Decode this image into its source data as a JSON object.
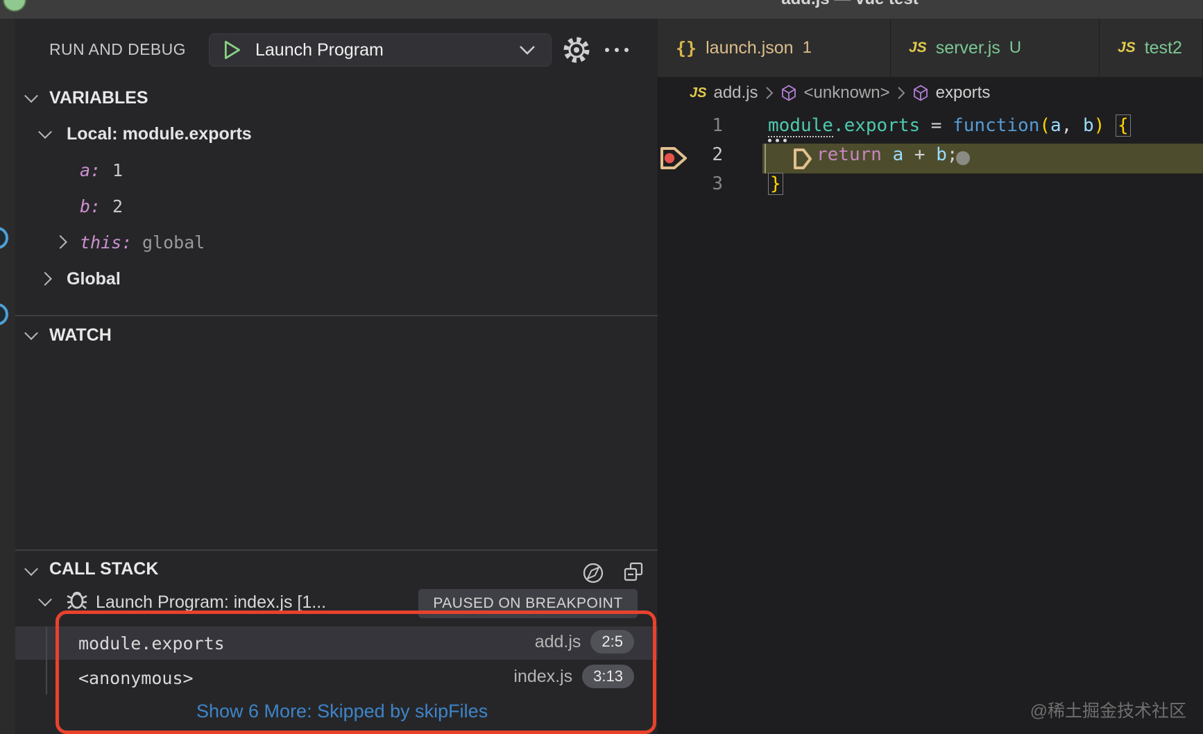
{
  "title_bar": {
    "title": "add.js — vue test"
  },
  "sidebar": {
    "header": {
      "label": "RUN AND DEBUG",
      "config_name": "Launch Program",
      "more_actions": "···"
    },
    "variables": {
      "header": "VARIABLES",
      "scope_local": "Local: module.exports",
      "items": [
        {
          "name": "a:",
          "value": "1"
        },
        {
          "name": "b:",
          "value": "2"
        },
        {
          "name": "this:",
          "value": "global"
        }
      ],
      "scope_global": "Global"
    },
    "watch": {
      "header": "WATCH"
    },
    "call_stack": {
      "header": "CALL STACK",
      "session_label": "Launch Program: index.js [1...",
      "status_badge": "PAUSED ON BREAKPOINT",
      "frames": [
        {
          "fn": "module.exports",
          "file": "add.js",
          "pos": "2:5"
        },
        {
          "fn": "<anonymous>",
          "file": "index.js",
          "pos": "3:13"
        }
      ],
      "skip_link": "Show 6 More: Skipped by skipFiles"
    }
  },
  "editor": {
    "tabs": [
      {
        "icon": "{}",
        "label": "launch.json",
        "badge": "1"
      },
      {
        "icon": "JS",
        "label": "server.js",
        "badge": "U"
      },
      {
        "icon": "JS",
        "label": "test2",
        "badge": ""
      }
    ],
    "breadcrumb": {
      "file_icon": "JS",
      "file": "add.js",
      "symbol1": "<unknown>",
      "symbol2": "exports"
    },
    "code": {
      "line_numbers": [
        "1",
        "2",
        "3"
      ],
      "l1": {
        "obj_head": "module",
        "obj_rest": ".exports",
        "eq": " = ",
        "kw": "function",
        "p1": "(",
        "a": "a",
        "comma": ", ",
        "b": "b",
        "p2": ")",
        "sp": " ",
        "brace": "{"
      },
      "l2": {
        "kw": "return",
        "sp": " ",
        "a": "a",
        "plus": " + ",
        "b": "b",
        "semi": ";"
      },
      "l3": {
        "brace": "}"
      }
    }
  },
  "watermark": "@稀土掘金技术社区",
  "colors": {
    "annotation_red": "#e8422c",
    "link_blue": "#3e85c8",
    "tab_modified_yellow": "#debf8d",
    "tab_untracked_green": "#7cc795",
    "breakpoint_red": "#e5534b",
    "debug_play_green": "#89d185",
    "symbol_purple": "#b180d7",
    "current_line_highlight": "#4d4d2d",
    "variable_purple": "#cd8fd0"
  }
}
